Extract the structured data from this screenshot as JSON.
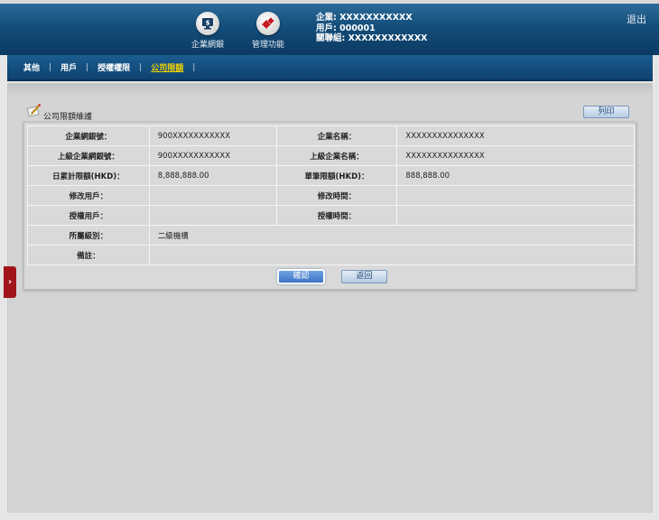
{
  "header": {
    "nav": [
      {
        "label": "企業網銀",
        "icon": "dollar-monitor-icon"
      },
      {
        "label": "管理功能",
        "icon": "gears-icon"
      }
    ],
    "user": {
      "enterprise": "企業: XXXXXXXXXXX",
      "user": "用戶: 000001",
      "group": "關聯組: XXXXXXXXXXXX"
    },
    "logout_label": "退出",
    "colors": {
      "header_top": "#2c6b9a",
      "header_bottom": "#0b3a62",
      "menu_active": "#f2d400",
      "side_tab": "#a2141b"
    }
  },
  "menu": {
    "items": [
      {
        "label": "其他",
        "active": false
      },
      {
        "label": "用戶",
        "active": false
      },
      {
        "label": "授權權限",
        "active": false
      },
      {
        "label": "公司限額",
        "active": true
      }
    ],
    "separator": "|"
  },
  "side_tab": {
    "arrow": "›"
  },
  "panel": {
    "title": "公司限額維護",
    "icon": "pencil-paper-icon",
    "print_label": "列印"
  },
  "form": {
    "rows": [
      {
        "l1": "企業網銀號：",
        "v1": "900XXXXXXXXXXX",
        "l2": "企業名稱：",
        "v2": "XXXXXXXXXXXXXXX"
      },
      {
        "l1": "上級企業網銀號：",
        "v1": "900XXXXXXXXXXX",
        "l2": "上級企業名稱：",
        "v2": "XXXXXXXXXXXXXXX"
      },
      {
        "l1": "日累計限額(HKD)：",
        "v1": "8,888,888.00",
        "l2": "單筆限額(HKD)：",
        "v2": "888,888.00"
      },
      {
        "l1": "修改用戶：",
        "v1": "",
        "l2": "修改時間：",
        "v2": ""
      },
      {
        "l1": "授權用戶：",
        "v1": "",
        "l2": "授權時間：",
        "v2": ""
      }
    ],
    "level_label": "所屬級別：",
    "level_value": "二級機構",
    "remark_label": "備註：",
    "remark_value": "",
    "confirm_label": "確認",
    "back_label": "返回"
  }
}
